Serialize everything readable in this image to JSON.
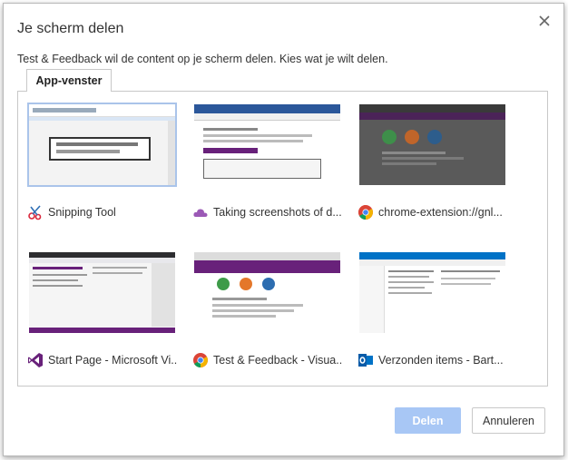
{
  "dialog": {
    "title": "Je scherm delen",
    "description": "Test & Feedback wil de content op je scherm delen. Kies wat je wilt delen.",
    "tab_label": "App-venster"
  },
  "windows": [
    {
      "label": "Snipping Tool",
      "icon": "scissors-icon"
    },
    {
      "label": "Taking screenshots of d...",
      "icon": "cloud-icon"
    },
    {
      "label": "chrome-extension://gnl...",
      "icon": "chrome-icon"
    },
    {
      "label": "Start Page - Microsoft Vi...",
      "icon": "visual-studio-icon"
    },
    {
      "label": "Test & Feedback - Visua...",
      "icon": "chrome-icon"
    },
    {
      "label": "Verzonden items - Bart...",
      "icon": "outlook-icon"
    }
  ],
  "buttons": {
    "share": "Delen",
    "cancel": "Annuleren"
  },
  "colors": {
    "share_button": "#a8c7f5",
    "selected_outline": "#aac4ea",
    "purple_header": "#68217a"
  }
}
